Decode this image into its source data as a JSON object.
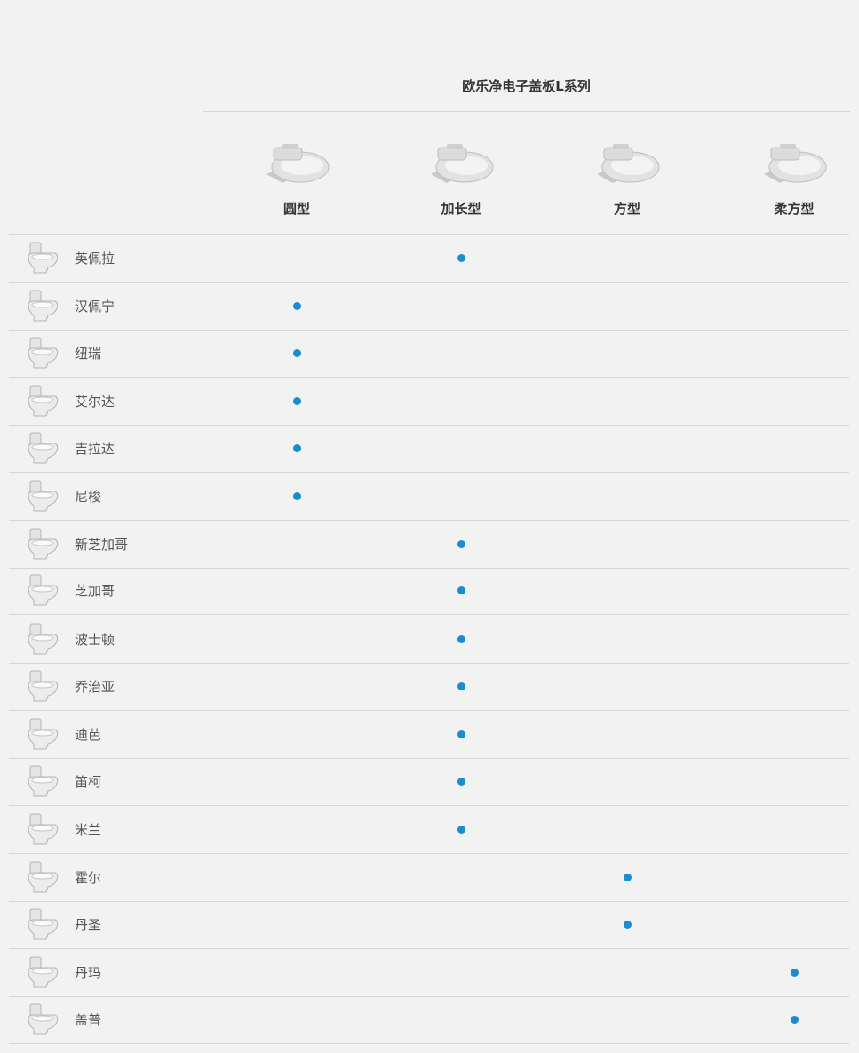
{
  "series_title": "欧乐净电子盖板L系列",
  "columns": [
    {
      "label": "圆型",
      "icon": "seat-round-icon"
    },
    {
      "label": "加长型",
      "icon": "seat-elongated-icon"
    },
    {
      "label": "方型",
      "icon": "seat-square-icon"
    },
    {
      "label": "柔方型",
      "icon": "seat-soft-square-icon"
    }
  ],
  "rows": [
    {
      "name": "英佩拉",
      "fit": "加长型"
    },
    {
      "name": "汉佩宁",
      "fit": "圆型"
    },
    {
      "name": "纽瑞",
      "fit": "圆型"
    },
    {
      "name": "艾尔达",
      "fit": "圆型"
    },
    {
      "name": "吉拉达",
      "fit": "圆型"
    },
    {
      "name": "尼梭",
      "fit": "圆型"
    },
    {
      "name": "新芝加哥",
      "fit": "加长型"
    },
    {
      "name": "芝加哥",
      "fit": "加长型"
    },
    {
      "name": "波士顿",
      "fit": "加长型"
    },
    {
      "name": "乔治亚",
      "fit": "加长型"
    },
    {
      "name": "迪芭",
      "fit": "加长型"
    },
    {
      "name": "笛柯",
      "fit": "加长型"
    },
    {
      "name": "米兰",
      "fit": "加长型"
    },
    {
      "name": "霍尔",
      "fit": "方型"
    },
    {
      "name": "丹圣",
      "fit": "方型"
    },
    {
      "name": "丹玛",
      "fit": "柔方型"
    },
    {
      "name": "盖普",
      "fit": "柔方型"
    }
  ],
  "colors": {
    "marker": "#1b8cd0",
    "background": "#f2f2f2",
    "divider": "#d6d6d6"
  }
}
